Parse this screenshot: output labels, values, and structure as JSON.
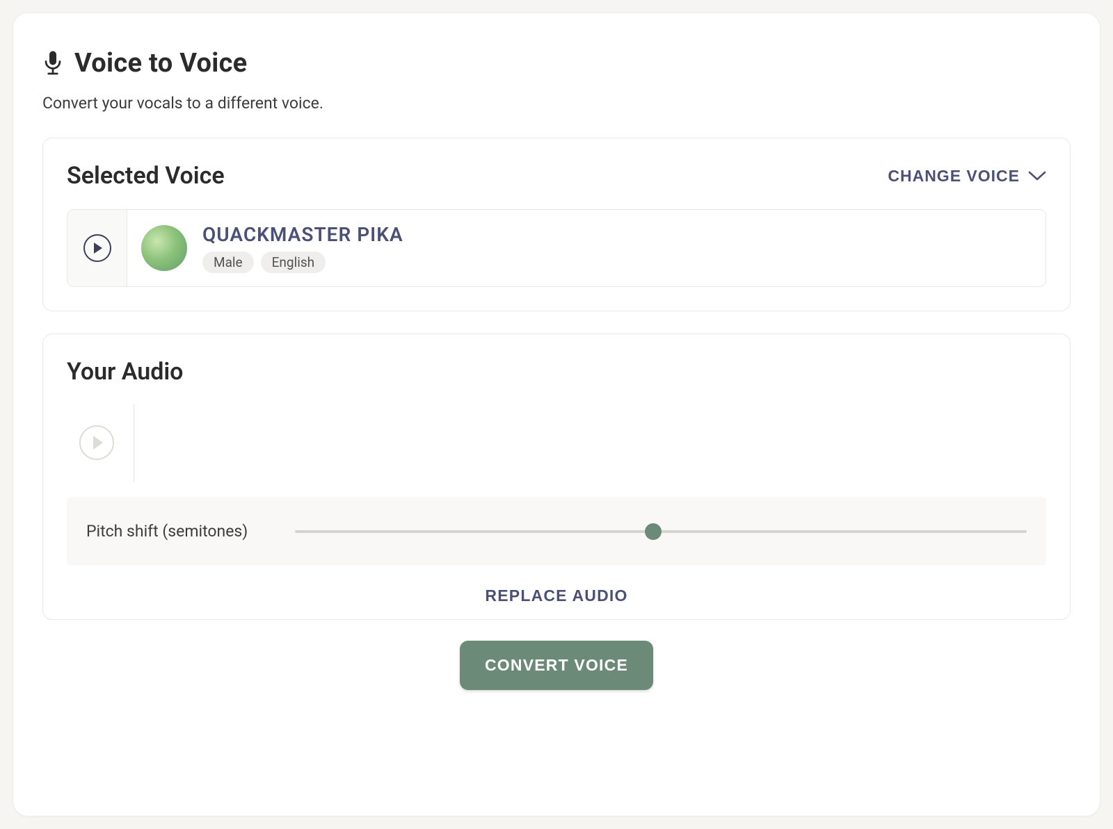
{
  "header": {
    "title": "Voice to Voice",
    "subtitle": "Convert your vocals to a different voice."
  },
  "selected_voice_panel": {
    "title": "Selected Voice",
    "change_label": "CHANGE VOICE",
    "voice": {
      "name": "QUACKMASTER PIKA",
      "tags": [
        "Male",
        "English"
      ]
    }
  },
  "your_audio_panel": {
    "title": "Your Audio",
    "pitch_label": "Pitch shift (semitones)",
    "pitch_percent": 49,
    "replace_label": "REPLACE AUDIO"
  },
  "actions": {
    "convert_label": "CONVERT VOICE"
  },
  "colors": {
    "accent_green": "#6c8a78",
    "link_indigo": "#4a5077"
  }
}
